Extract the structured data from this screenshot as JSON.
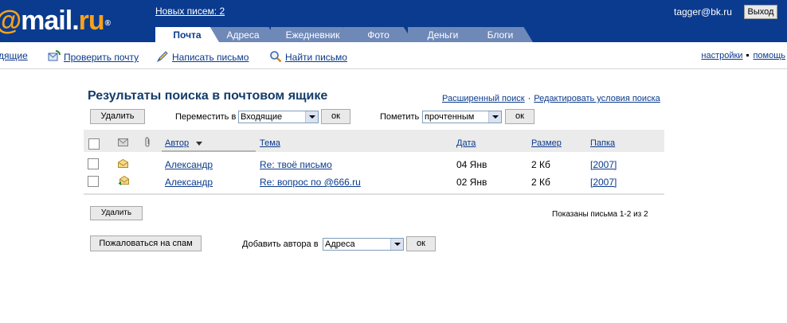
{
  "header": {
    "logo": {
      "at": "@",
      "main": "mail.",
      "ru": "ru",
      "reg": "®"
    },
    "new_mail": "Новых писем: 2",
    "user_email": "tagger@bk.ru",
    "logout": "Выход",
    "tabs": [
      {
        "label": "Почта",
        "active": true
      },
      {
        "label": "Адреса"
      },
      {
        "label": "Ежедневник"
      },
      {
        "label": "Фото"
      },
      {
        "label": "Деньги"
      },
      {
        "label": "Блоги"
      }
    ]
  },
  "toolbar": {
    "partial": "дящие",
    "check_mail": "Проверить почту",
    "write": "Написать письмо",
    "find": "Найти письмо",
    "settings": "настройки",
    "help": "помощь"
  },
  "main": {
    "title": "Результаты поиска в почтовом ящике",
    "advanced_search": "Расширенный поиск",
    "edit_conditions": "Редактировать условия поиска",
    "delete": "Удалить",
    "move_label": "Переместить в",
    "move_value": "Входящие",
    "ok": "ок",
    "mark_label": "Пометить",
    "mark_value": "прочтенным",
    "shown": "Показаны письма 1-2 из 2",
    "spam": "Пожаловаться на спам",
    "add_author_label": "Добавить автора в",
    "add_author_value": "Адреса"
  },
  "table": {
    "headers": {
      "author": "Автор",
      "subject": "Тема",
      "date": "Дата",
      "size": "Размер",
      "folder": "Папка"
    },
    "rows": [
      {
        "author": "Александр",
        "subject": "Re: твоё письмо",
        "date": "04 Янв",
        "size": "2 Кб",
        "folder": "[2007]"
      },
      {
        "author": "Александр",
        "subject": "Re: вопрос по @666.ru",
        "date": "02 Янв",
        "size": "2 Кб",
        "folder": "[2007]"
      }
    ]
  }
}
